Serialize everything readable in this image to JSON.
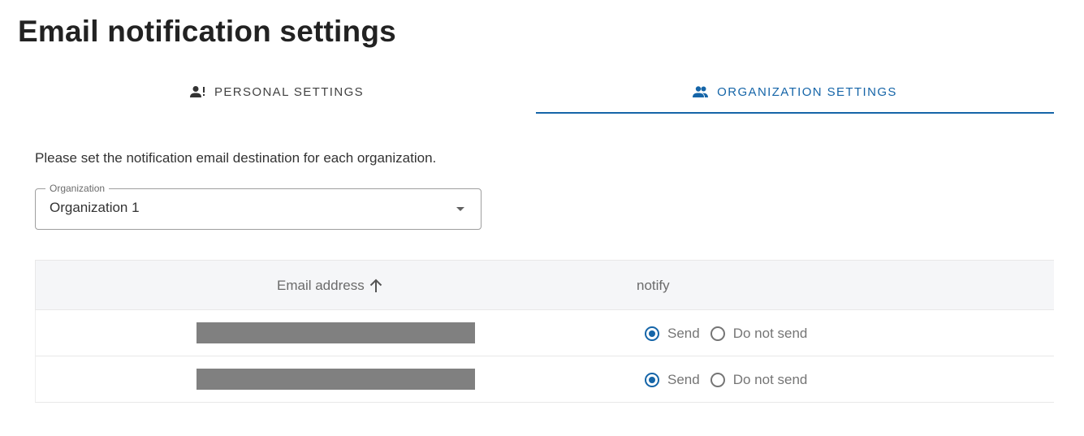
{
  "page": {
    "title": "Email notification settings"
  },
  "tabs": [
    {
      "label": "PERSONAL SETTINGS",
      "icon": "person-alert-icon",
      "active": false
    },
    {
      "label": "ORGANIZATION SETTINGS",
      "icon": "people-icon",
      "active": true
    }
  ],
  "description": "Please set the notification email destination for each organization.",
  "organization_select": {
    "label": "Organization",
    "value": "Organization 1"
  },
  "table": {
    "headers": {
      "email": "Email address",
      "email_sort": "ascending",
      "notify": "notify"
    },
    "rows": [
      {
        "email": "[redacted]",
        "send_label": "Send",
        "no_send_label": "Do not send",
        "selected": "Send"
      },
      {
        "email": "[redacted]",
        "send_label": "Send",
        "no_send_label": "Do not send",
        "selected": "Send"
      }
    ]
  },
  "colors": {
    "accent": "#1565a8",
    "header_bg": "#f5f6f8",
    "redaction": "#808080"
  }
}
